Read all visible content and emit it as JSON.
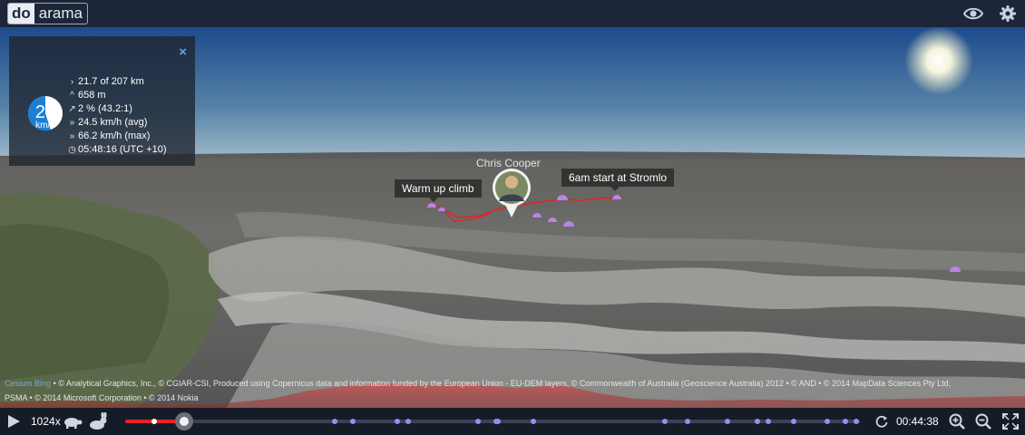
{
  "app": {
    "logo_part1": "do",
    "logo_part2": "arama"
  },
  "header": {
    "icons": [
      "eye-icon",
      "gear-icon"
    ]
  },
  "stats": {
    "speed_value": "28",
    "speed_unit": "km/h",
    "speed_gauge_fraction": 0.45,
    "rows": [
      {
        "icon": "›",
        "text": "21.7 of 207 km"
      },
      {
        "icon": "^",
        "text": "658 m"
      },
      {
        "icon": "↗",
        "text": "2 % (43.2:1)"
      },
      {
        "icon": "»",
        "text": "24.5 km/h (avg)"
      },
      {
        "icon": "»",
        "text": "66.2 km/h (max)"
      },
      {
        "icon": "◷",
        "text": "05:48:16 (UTC +10)"
      }
    ],
    "close_icon": "×"
  },
  "map": {
    "callouts": [
      "Warm up climb",
      "6am start at Stromlo"
    ],
    "person_name": "Chris Cooper",
    "colors": {
      "track": "#e0242a",
      "marker": "#b983e8",
      "sky_top": "#1d4b8c",
      "sky_horizon": "#8fb0c6"
    }
  },
  "attribution": {
    "links": [
      "Cesium",
      "Bing"
    ],
    "line1": "• © Analytical Graphics, Inc., © CGIAR-CSI, Produced using Copernicus data and information funded by the European Union - EU-DEM layers, © Commonwealth of Australia (Geoscience Australia) 2012 • © AND • © 2014 MapData Sciences Pty Ltd,",
    "line2": "PSMA • © 2014 Microsoft Corporation • © 2014 Nokia"
  },
  "playback": {
    "speed": "1024x",
    "time": "00:44:38",
    "progress_fraction": 0.08,
    "markers_fraction": [
      0.04,
      0.285,
      0.31,
      0.37,
      0.385,
      0.48,
      0.505,
      0.508,
      0.555,
      0.735,
      0.765,
      0.82,
      0.86,
      0.875,
      0.91,
      0.955,
      0.98,
      0.995
    ]
  }
}
